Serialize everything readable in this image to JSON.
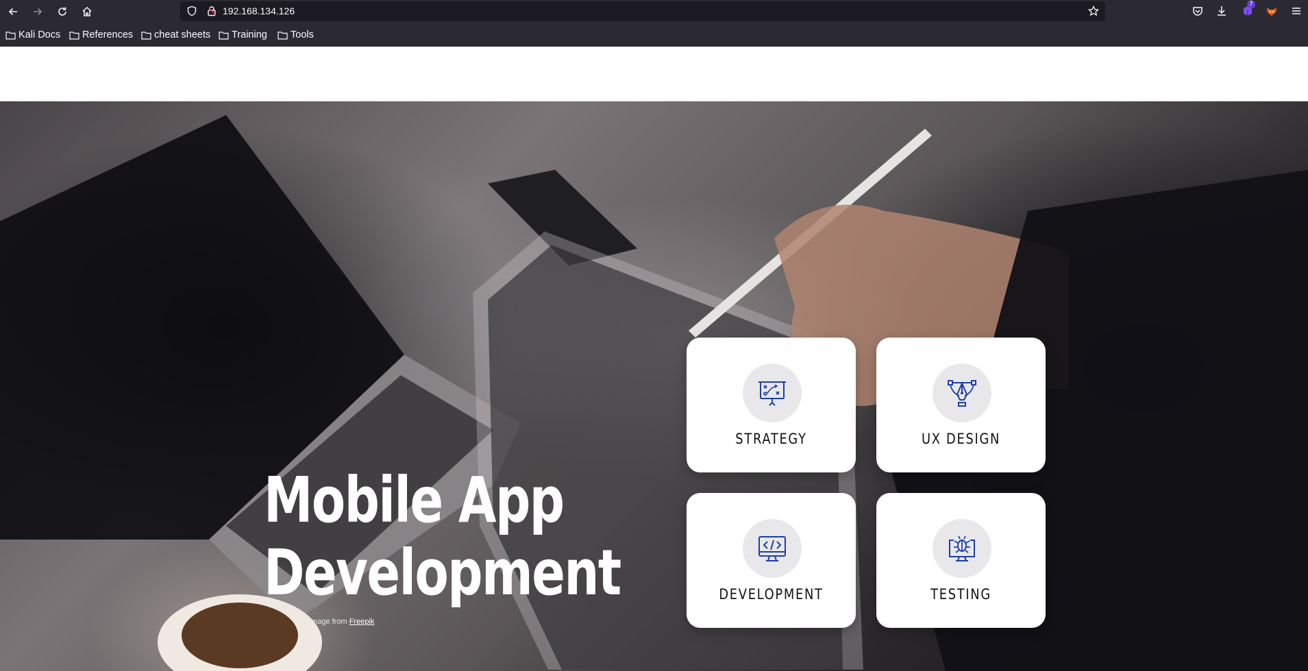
{
  "browser": {
    "url": "192.168.134.126",
    "extension_badge": "7",
    "bookmarks": [
      "Kali Docs",
      "References",
      "cheat sheets",
      "Training",
      "Tools"
    ]
  },
  "hero": {
    "title_line1": "Mobile App",
    "title_line2": "Development",
    "credit_prefix": "Image from",
    "credit_link": "Freepik"
  },
  "cards": [
    {
      "label": "STRATEGY",
      "icon": "strategy-board-icon"
    },
    {
      "label": "UX DESIGN",
      "icon": "pen-tool-icon"
    },
    {
      "label": "DEVELOPMENT",
      "icon": "code-monitor-icon"
    },
    {
      "label": "TESTING",
      "icon": "bug-monitor-icon"
    }
  ],
  "colors": {
    "chrome_bg": "#2b2a33",
    "urlbar_bg": "#1c1b22",
    "icon_accent": "#1e3ea8",
    "card_bg": "#ffffff"
  }
}
